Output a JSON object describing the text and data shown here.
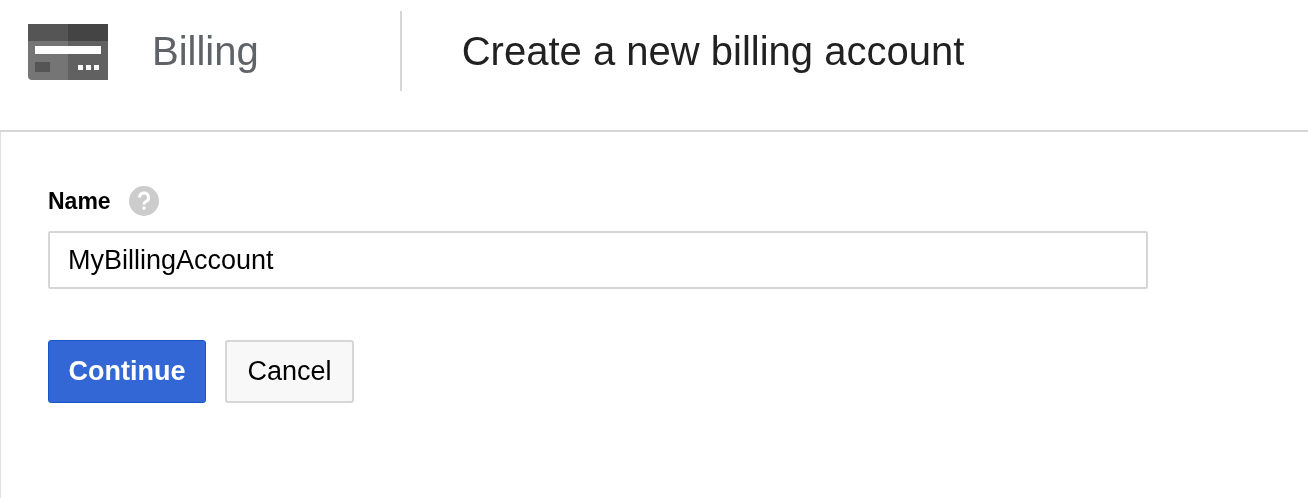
{
  "header": {
    "app_title": "Billing",
    "page_title": "Create a new billing account"
  },
  "form": {
    "label": "Name",
    "value": "MyBillingAccount"
  },
  "buttons": [
    {
      "label": "Continue",
      "kind": "primary"
    },
    {
      "label": "Cancel",
      "kind": "default"
    }
  ]
}
